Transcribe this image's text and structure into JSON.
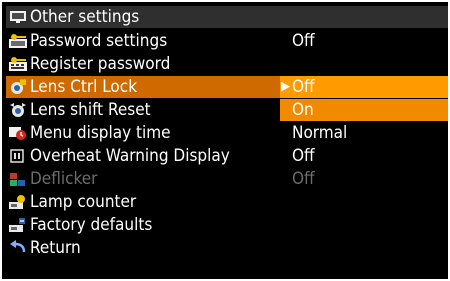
{
  "menu": {
    "title": "Other settings",
    "title_icon": "monitor-icon",
    "items": [
      {
        "label": "Password settings",
        "value": "Off",
        "icon": "key-monitor-icon"
      },
      {
        "label": "Register password",
        "value": "",
        "icon": "key-keypad-icon"
      },
      {
        "label": "Lens Ctrl Lock",
        "value": "Off",
        "icon": "lens-lock-icon",
        "selected": true
      },
      {
        "label": "Lens shift Reset",
        "value": "On",
        "icon": "lens-shift-icon"
      },
      {
        "label": "Menu display time",
        "value": "Normal",
        "icon": "clock-icon"
      },
      {
        "label": "Overheat Warning Display",
        "value": "Off",
        "icon": "warning-icon"
      },
      {
        "label": "Deflicker",
        "value": "Off",
        "icon": "deflicker-icon",
        "disabled": true
      },
      {
        "label": "Lamp counter",
        "value": "",
        "icon": "lamp-icon"
      },
      {
        "label": "Factory defaults",
        "value": "",
        "icon": "factory-icon"
      },
      {
        "label": "Return",
        "value": "",
        "icon": "return-arrow-icon"
      }
    ],
    "selection_arrow": "▶"
  },
  "colors": {
    "background": "#000000",
    "title_bar": "#2f2f2f",
    "selected_row": "#cf6a00",
    "option_highlight": "#f28a00",
    "disabled_text": "#6d6d6d",
    "text": "#ffffff"
  }
}
